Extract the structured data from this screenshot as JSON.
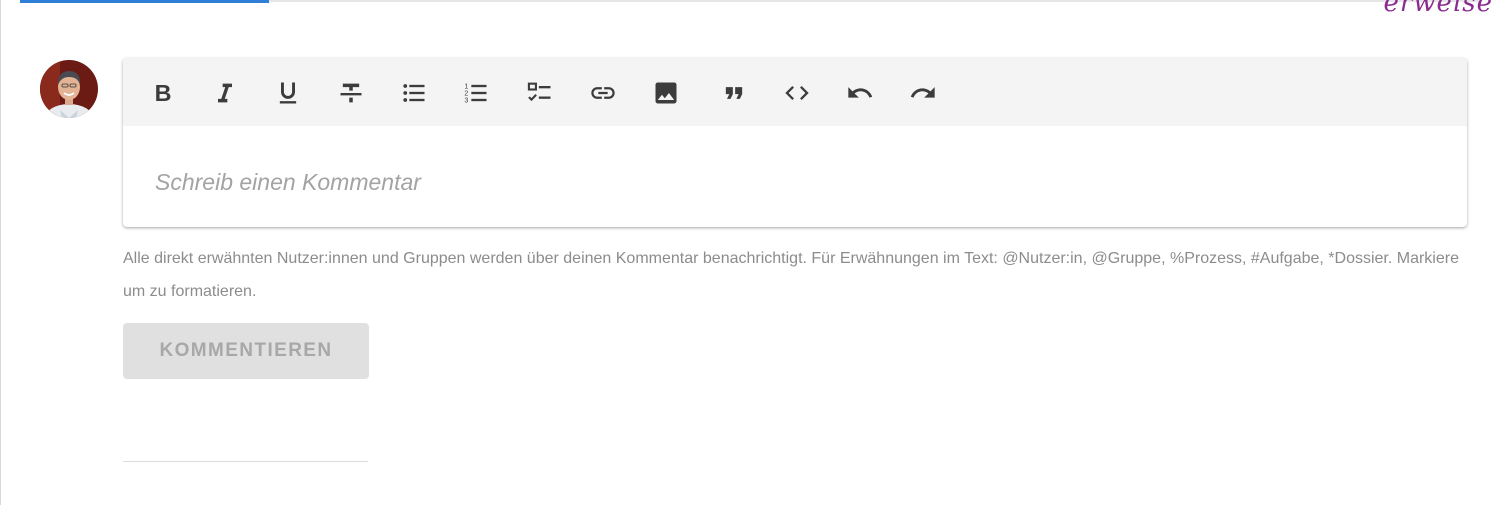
{
  "tabs": {
    "active_accent": "#2f7ed8"
  },
  "corner_text": "erweise",
  "avatar": {
    "icon": "user-avatar-photo"
  },
  "toolbar": {
    "buttons": [
      {
        "id": "bold",
        "icon": "bold-icon"
      },
      {
        "id": "italic",
        "icon": "italic-icon"
      },
      {
        "id": "underline",
        "icon": "underline-icon"
      },
      {
        "id": "strikethrough",
        "icon": "strikethrough-icon"
      },
      {
        "id": "bullet-list",
        "icon": "bullet-list-icon"
      },
      {
        "id": "numbered-list",
        "icon": "numbered-list-icon"
      },
      {
        "id": "checklist",
        "icon": "checklist-icon"
      },
      {
        "id": "link",
        "icon": "link-icon"
      },
      {
        "id": "image",
        "icon": "image-icon"
      },
      {
        "id": "quote",
        "icon": "quote-icon"
      },
      {
        "id": "code",
        "icon": "code-icon"
      },
      {
        "id": "undo",
        "icon": "undo-icon"
      },
      {
        "id": "redo",
        "icon": "redo-icon"
      }
    ]
  },
  "editor": {
    "placeholder": "Schreib einen Kommentar",
    "value": ""
  },
  "hint": {
    "text": "Alle direkt erwähnten Nutzer:innen und Gruppen werden über deinen Kommentar benachrichtigt. Für Erwähnungen im Text: @Nutzer:in, @Gruppe, %Prozess, #Aufgabe, *Dossier. Markiere um zu formatieren."
  },
  "actions": {
    "submit_label": "KOMMENTIEREN",
    "submit_enabled": false
  },
  "colors": {
    "toolbar_icon": "#3c3c3c",
    "toolbar_bg": "#f4f4f4",
    "hint_text": "#8c8c8c",
    "button_disabled_bg": "#e0e0e0",
    "button_disabled_text": "#a8a8a8"
  }
}
